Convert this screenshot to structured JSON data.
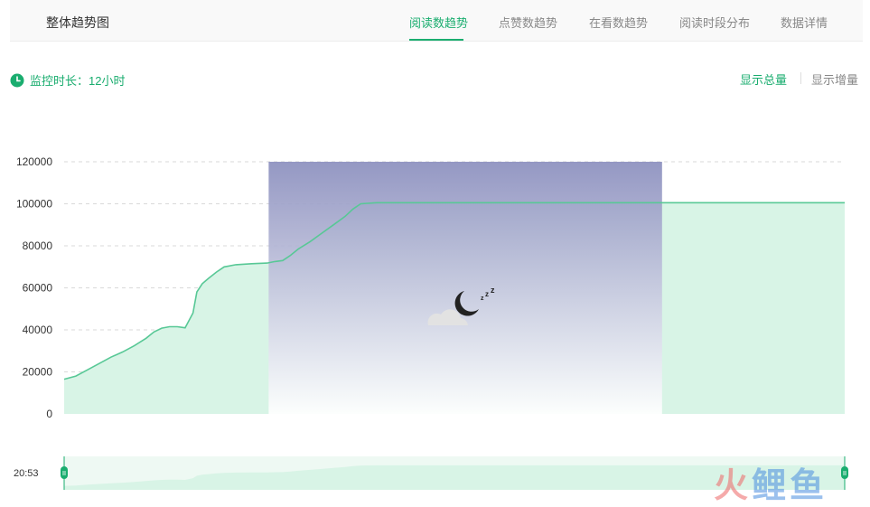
{
  "header": {
    "title": "整体趋势图",
    "tabs": [
      {
        "label": "阅读数趋势",
        "active": true
      },
      {
        "label": "点赞数趋势",
        "active": false
      },
      {
        "label": "在看数趋势",
        "active": false
      },
      {
        "label": "阅读时段分布",
        "active": false
      },
      {
        "label": "数据详情",
        "active": false
      }
    ]
  },
  "monitor": {
    "label": "监控时长：12小时",
    "icon": "clock-icon"
  },
  "view_toggle": {
    "total_label": "显示总量",
    "increment_label": "显示增量",
    "selected": "total"
  },
  "colors": {
    "accent": "#1aad6f",
    "line": "#58c896",
    "area": "#d8f4e6",
    "night_top": "#8b8fbe",
    "night_bottom": "#ffffff"
  },
  "night_icon": "moon-cloud-icon",
  "zoom": {
    "start_label": "20:53"
  },
  "watermark": {
    "part1": "火",
    "part2": "鲤鱼"
  },
  "chart_data": {
    "type": "area",
    "title": "",
    "xlabel": "",
    "ylabel": "",
    "ylim": [
      0,
      120000
    ],
    "yticks": [
      0,
      20000,
      40000,
      60000,
      80000,
      100000,
      120000
    ],
    "grid": true,
    "x_range": [
      0,
      100
    ],
    "night_span": [
      26.2,
      76.6
    ],
    "series": [
      {
        "values": [
          [
            0,
            16500
          ],
          [
            1.5,
            18000
          ],
          [
            3,
            21000
          ],
          [
            4.5,
            24000
          ],
          [
            6,
            27000
          ],
          [
            7.5,
            29500
          ],
          [
            9,
            32500
          ],
          [
            10.5,
            36000
          ],
          [
            11.5,
            39000
          ],
          [
            12.5,
            40800
          ],
          [
            13.5,
            41500
          ],
          [
            14.5,
            41500
          ],
          [
            15.5,
            41000
          ],
          [
            16.5,
            48000
          ],
          [
            17,
            58000
          ],
          [
            17.7,
            62000
          ],
          [
            18.5,
            64500
          ],
          [
            19.5,
            67500
          ],
          [
            20.5,
            70000
          ],
          [
            22,
            71000
          ],
          [
            24,
            71500
          ],
          [
            26,
            71800
          ],
          [
            27,
            72500
          ],
          [
            28,
            73000
          ],
          [
            29,
            75500
          ],
          [
            30,
            78500
          ],
          [
            31.5,
            82000
          ],
          [
            33,
            86000
          ],
          [
            34.5,
            90000
          ],
          [
            36,
            94000
          ],
          [
            37,
            97500
          ],
          [
            38,
            100000
          ],
          [
            40,
            100500
          ],
          [
            50,
            100500
          ],
          [
            60,
            100500
          ],
          [
            70,
            100500
          ],
          [
            80,
            100500
          ],
          [
            90,
            100500
          ],
          [
            100,
            100500
          ]
        ]
      }
    ]
  }
}
